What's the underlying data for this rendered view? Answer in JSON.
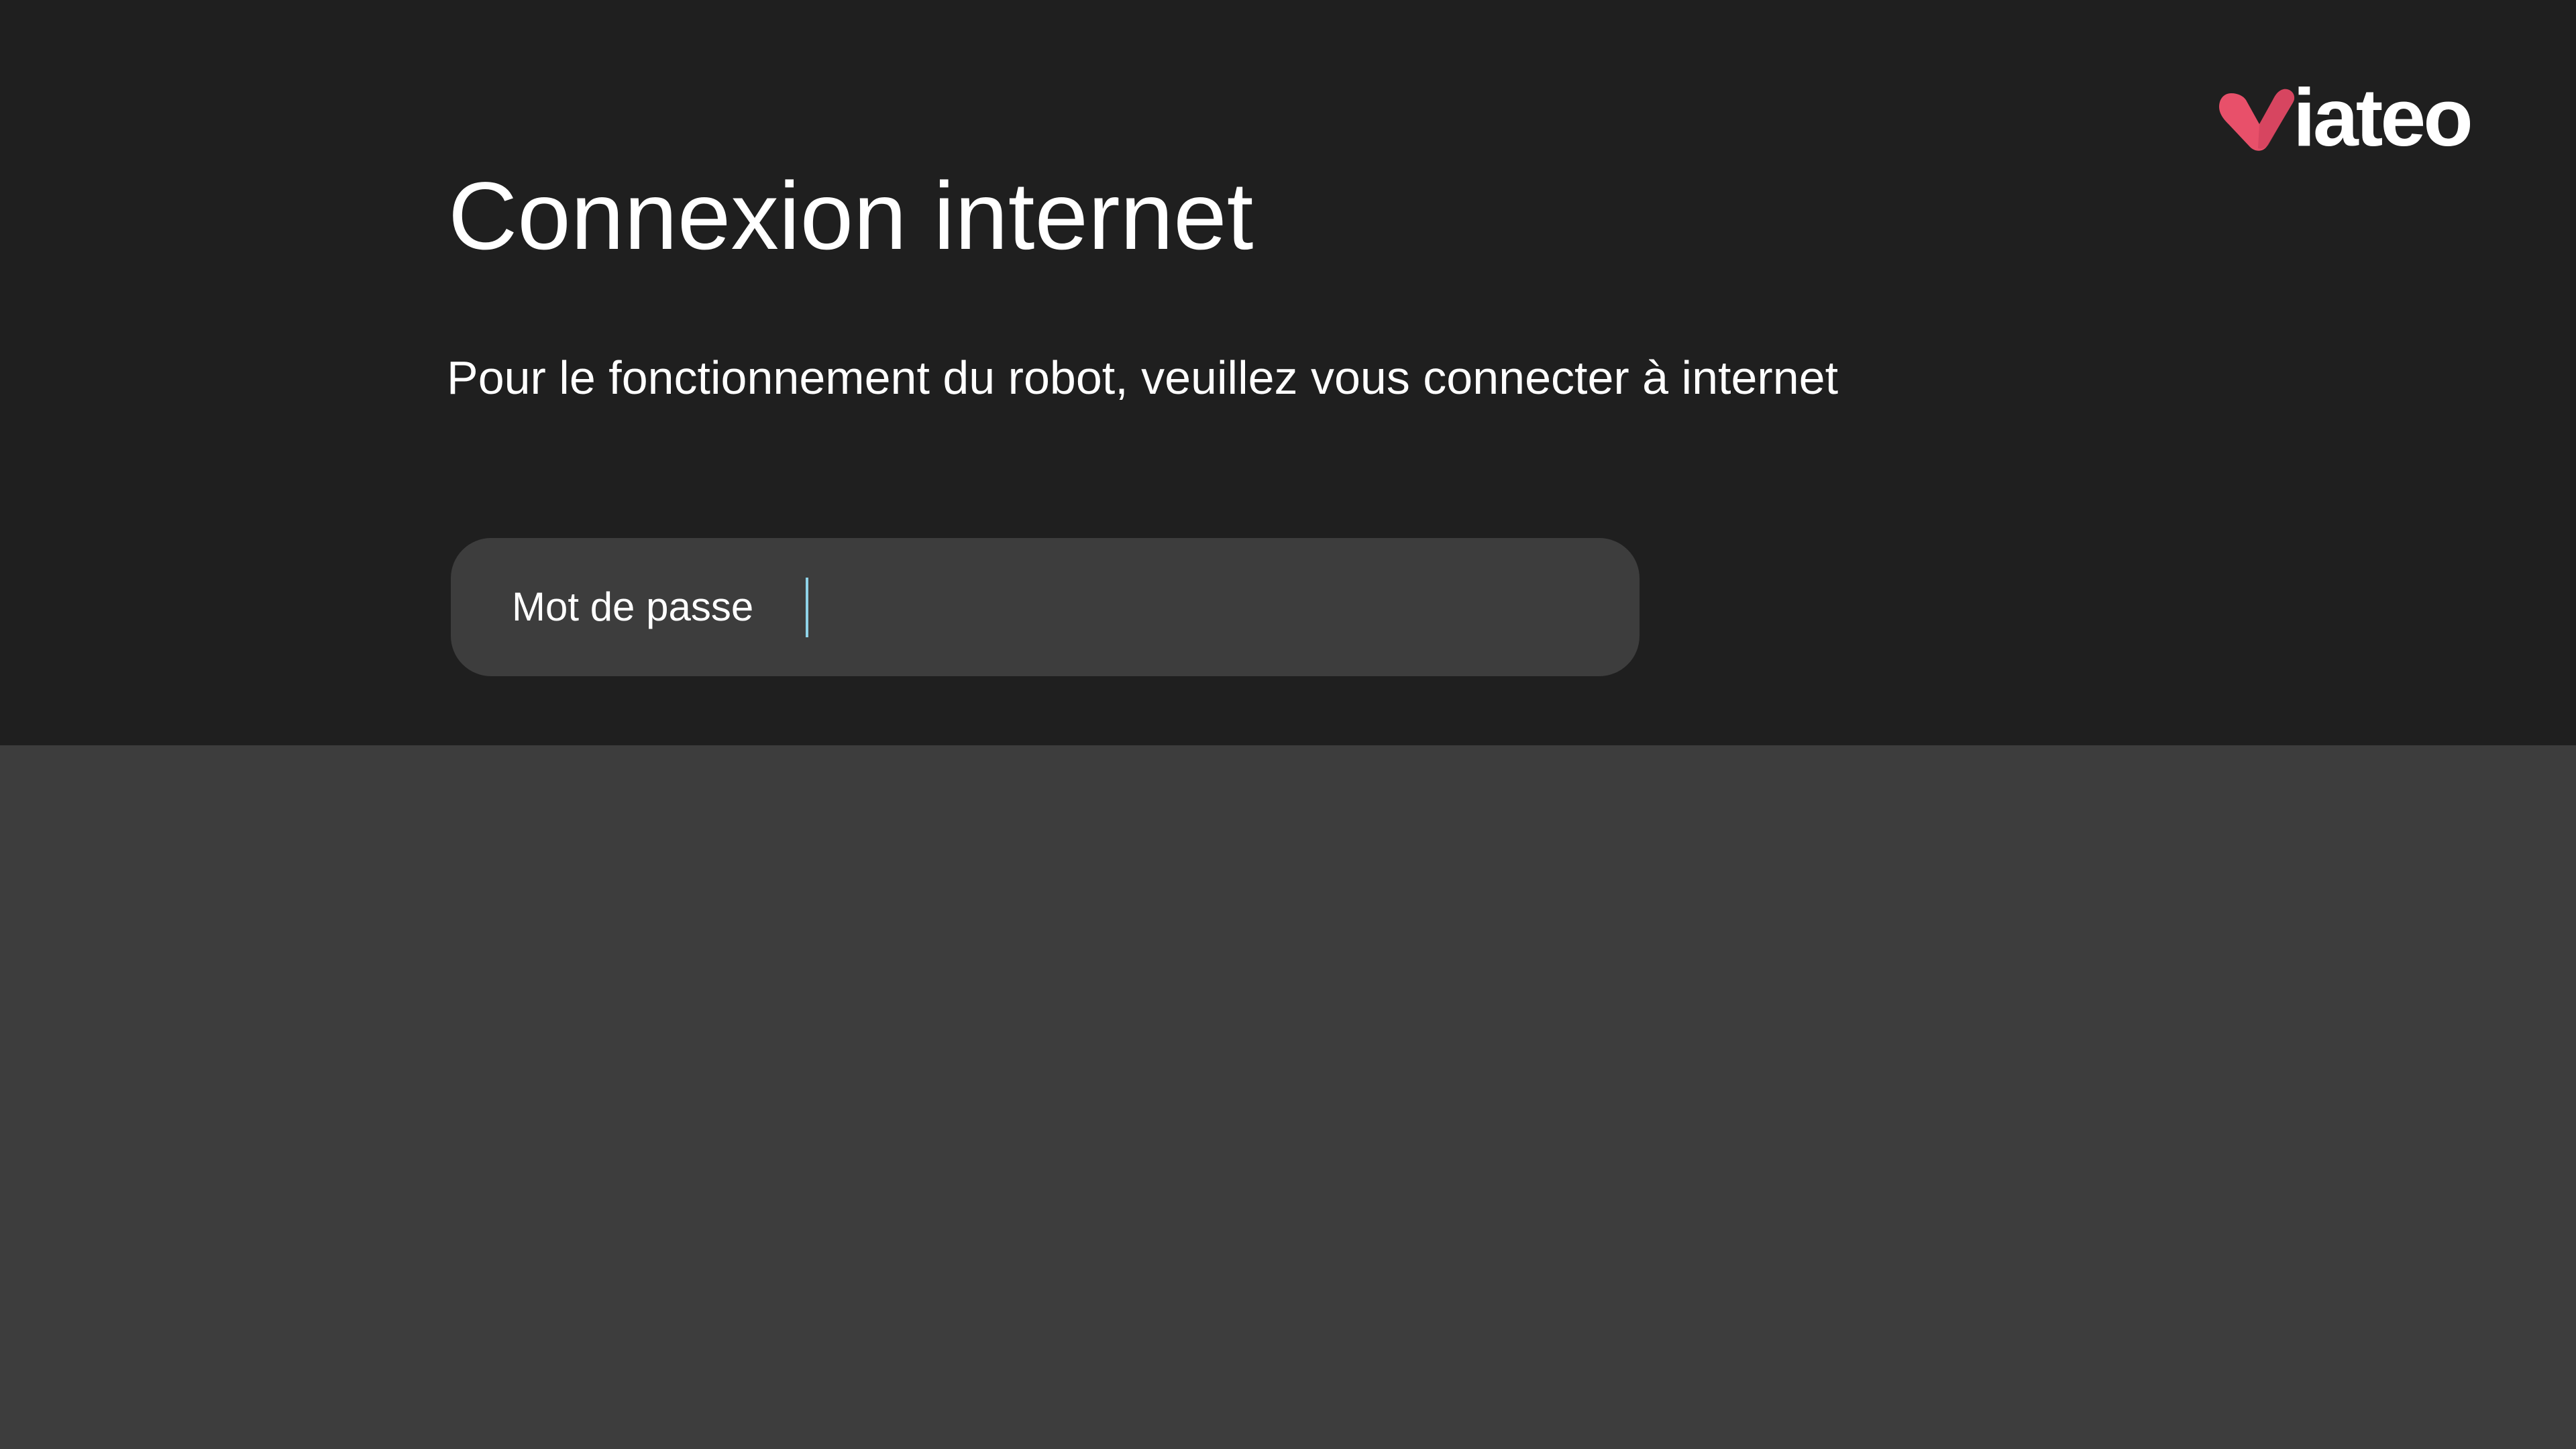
{
  "brand": {
    "logo_text": "iateo",
    "logo_icon": "heart-v-icon",
    "accent_color": "#e8506a"
  },
  "main": {
    "title": "Connexion internet",
    "subtitle": "Pour le fonctionnement du robot, veuillez vous connecter à internet"
  },
  "password_field": {
    "label": "Mot de passe",
    "value": "",
    "caret_color": "#8fd3e8"
  },
  "colors": {
    "top_background": "#1f1f1f",
    "bottom_background": "#3d3d3d",
    "field_background": "#3d3d3d",
    "text": "#ffffff"
  }
}
